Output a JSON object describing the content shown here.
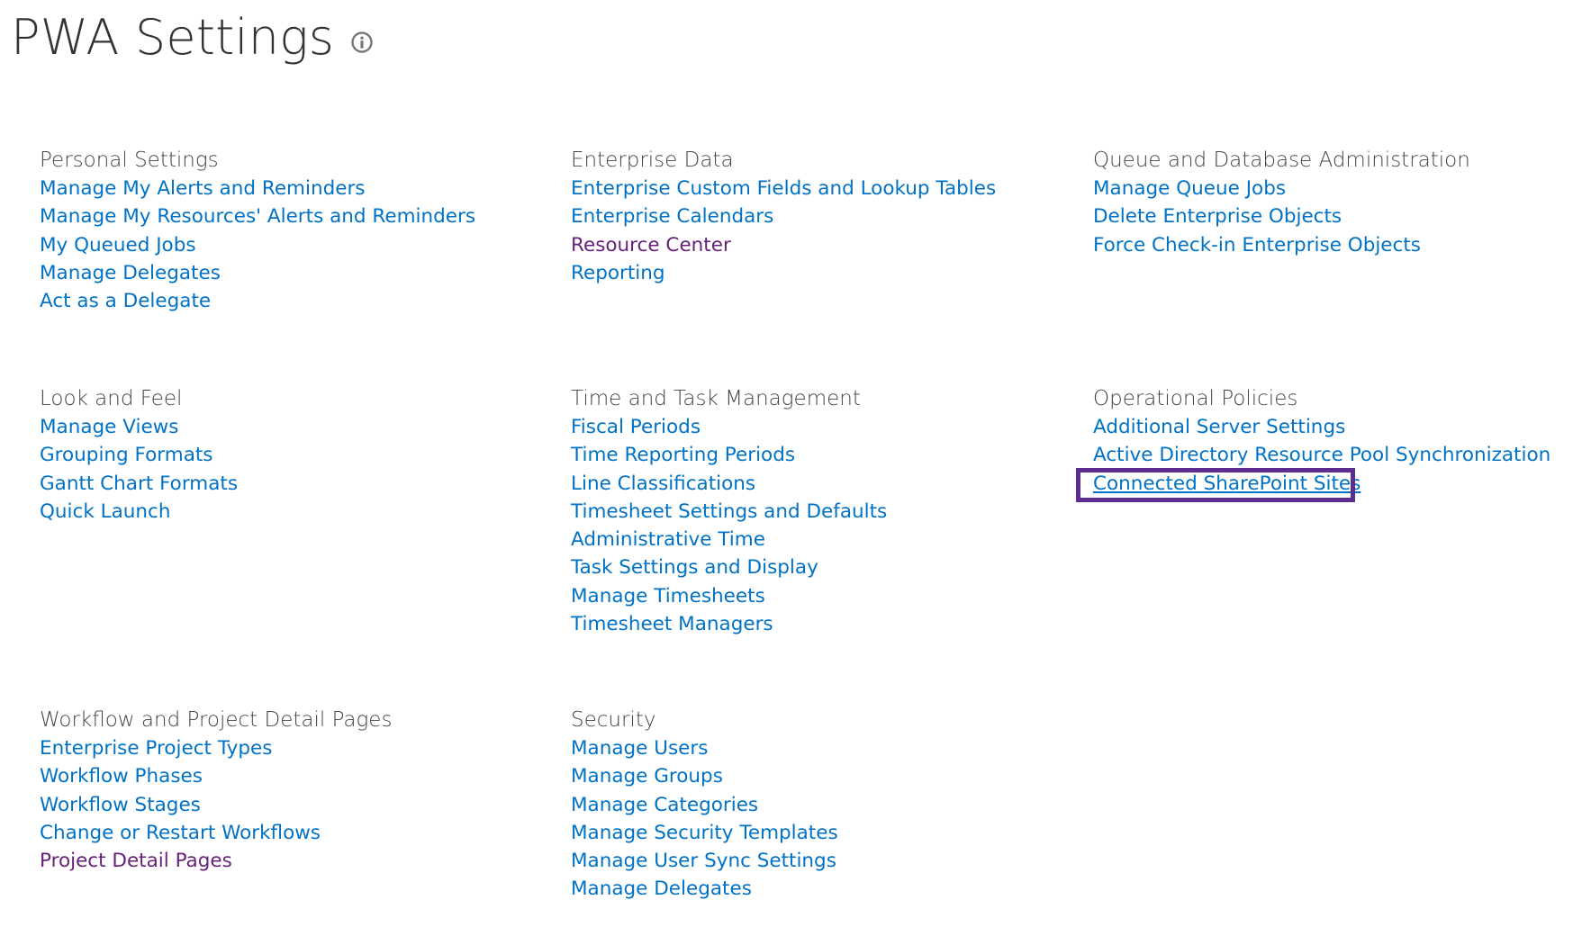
{
  "title": "PWA Settings",
  "colors": {
    "link": "#0072c6",
    "visited_link": "#68217a",
    "heading": "#444444",
    "highlight": "#5c2d91"
  },
  "sections": {
    "personal": {
      "heading": "Personal Settings",
      "links": [
        "Manage My Alerts and Reminders",
        "Manage My Resources' Alerts and Reminders",
        "My Queued Jobs",
        "Manage Delegates",
        "Act as a Delegate"
      ]
    },
    "enterprise": {
      "heading": "Enterprise Data",
      "links": [
        "Enterprise Custom Fields and Lookup Tables",
        "Enterprise Calendars",
        "Resource Center",
        "Reporting"
      ]
    },
    "queue": {
      "heading": "Queue and Database Administration",
      "links": [
        "Manage Queue Jobs",
        "Delete Enterprise Objects",
        "Force Check-in Enterprise Objects"
      ]
    },
    "look": {
      "heading": "Look and Feel",
      "links": [
        "Manage Views",
        "Grouping Formats",
        "Gantt Chart Formats",
        "Quick Launch"
      ]
    },
    "time": {
      "heading": "Time and Task Management",
      "links": [
        "Fiscal Periods",
        "Time Reporting Periods",
        "Line Classifications",
        "Timesheet Settings and Defaults",
        "Administrative Time",
        "Task Settings and Display",
        "Manage Timesheets",
        "Timesheet Managers"
      ]
    },
    "operational": {
      "heading": "Operational Policies",
      "links": [
        "Additional Server Settings",
        "Active Directory Resource Pool Synchronization",
        "Connected SharePoint Sites"
      ]
    },
    "workflow": {
      "heading": "Workflow and Project Detail Pages",
      "links": [
        "Enterprise Project Types",
        "Workflow Phases",
        "Workflow Stages",
        "Change or Restart Workflows",
        "Project Detail Pages"
      ]
    },
    "security": {
      "heading": "Security",
      "links": [
        "Manage Users",
        "Manage Groups",
        "Manage Categories",
        "Manage Security Templates",
        "Manage User Sync Settings",
        "Manage Delegates"
      ]
    }
  }
}
